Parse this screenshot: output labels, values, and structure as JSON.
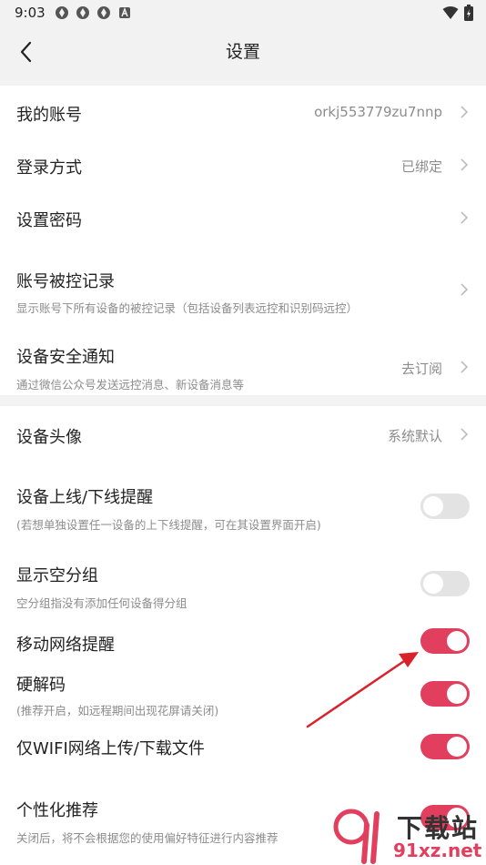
{
  "status_bar": {
    "time": "9:03"
  },
  "header": {
    "title": "设置"
  },
  "account_section": {
    "items": [
      {
        "title": "我的账号",
        "value": "orkj553779zu7nnp"
      },
      {
        "title": "登录方式",
        "value": "已绑定"
      },
      {
        "title": "设置密码"
      },
      {
        "title": "账号被控记录",
        "subtitle": "显示账号下所有设备的被控记录（包括设备列表远控和识别码远控）"
      },
      {
        "title": "设备安全通知",
        "subtitle": "通过微信公众号发送远控消息、新设备消息等",
        "value": "去订阅"
      }
    ]
  },
  "device_section": {
    "items": [
      {
        "title": "设备头像",
        "value": "系统默认"
      },
      {
        "title": "设备上线/下线提醒",
        "subtitle": "(若想单独设置任一设备的上下线提醒，可在其设置界面开启)",
        "toggle": "off"
      },
      {
        "title": "显示空分组",
        "subtitle": "空分组指没有添加任何设备得分组",
        "toggle": "off"
      },
      {
        "title": "移动网络提醒",
        "toggle": "on"
      },
      {
        "title": "硬解码",
        "subtitle": "(推荐开启，如远程期间出现花屏请关闭)",
        "toggle": "on"
      },
      {
        "title": "仅WIFI网络上传/下载文件",
        "toggle": "on"
      },
      {
        "title": "个性化推荐",
        "subtitle": "关闭后，将不会根据您的使用偏好特征进行内容推荐",
        "toggle": "on"
      }
    ]
  },
  "watermark": {
    "brand": "下载站",
    "domain": "91xz.net"
  },
  "colors": {
    "accent": "#e23f5f",
    "toggle_off": "#e3e3e3",
    "annotation_arrow": "#d9212b"
  }
}
